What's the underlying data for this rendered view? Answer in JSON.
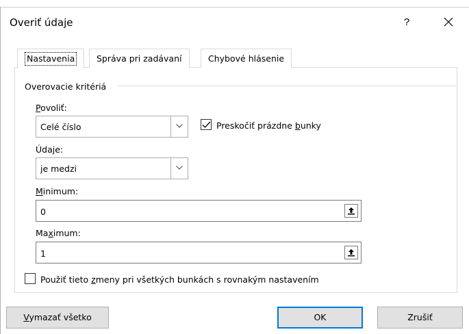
{
  "dialog": {
    "title": "Overiť údaje",
    "help_label": "?"
  },
  "tabs": [
    {
      "label": "Nastavenia"
    },
    {
      "label": "Správa pri zadávaní"
    },
    {
      "label": "Chybové hlásenie"
    }
  ],
  "criteria": {
    "section_label": "Overovacie kritériá",
    "allow_label_pre": "",
    "allow_label_key": "P",
    "allow_label_post": "ovoliť:",
    "allow_value": "Celé číslo",
    "ignore_blank_pre": "Preskočiť prázdne ",
    "ignore_blank_key": "b",
    "ignore_blank_post": "unky",
    "ignore_blank_checked": true,
    "data_label": "Údaje:",
    "data_value": "je medzi",
    "min_label_pre": "",
    "min_label_key": "M",
    "min_label_post": "inimum:",
    "min_value": "0",
    "max_label_pre": "Ma",
    "max_label_key": "x",
    "max_label_post": "imum:",
    "max_value": "1"
  },
  "apply_all": {
    "label_pre": "Použiť tieto ",
    "label_key": "z",
    "label_post": "meny pri všetkých bunkách s rovnakým nastavením",
    "checked": false
  },
  "buttons": {
    "clear_pre": "",
    "clear_key": "V",
    "clear_post": "ymazať všetko",
    "ok": "OK",
    "cancel": "Zrušiť"
  },
  "colors": {
    "accent": "#0078d7",
    "button_bg": "#e1e1e1",
    "border": "#adadad"
  }
}
